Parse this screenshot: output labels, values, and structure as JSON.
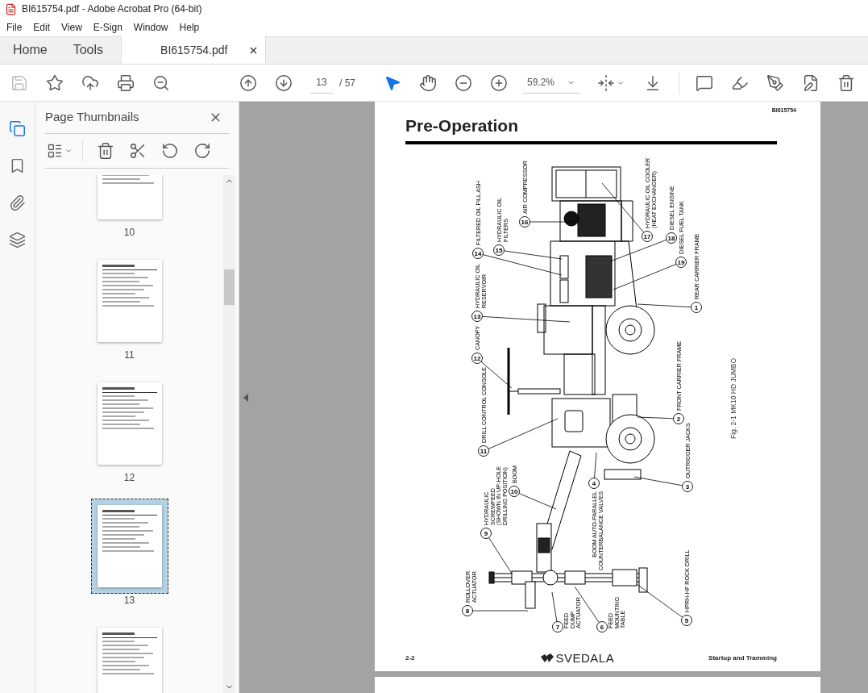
{
  "window": {
    "title": "BI615754.pdf - Adobe Acrobat Pro (64-bit)"
  },
  "menu": [
    "File",
    "Edit",
    "View",
    "E-Sign",
    "Window",
    "Help"
  ],
  "tabs": [
    {
      "label": "Home",
      "selected": false
    },
    {
      "label": "Tools",
      "selected": false
    },
    {
      "label": "BI615754.pdf",
      "selected": true
    }
  ],
  "toolbar": {
    "save_disabled": true,
    "page_current": "13",
    "page_total": "/ 57",
    "zoom": "59.2%",
    "tools": [
      {
        "kind": "select",
        "selected": true
      },
      {
        "kind": "hand",
        "selected": false
      }
    ]
  },
  "sidebar": {
    "rail": [
      {
        "kind": "pages",
        "selected": true
      },
      {
        "kind": "bookmarks",
        "selected": false
      },
      {
        "kind": "attachments",
        "selected": false
      },
      {
        "kind": "layers",
        "selected": false
      }
    ],
    "panel_title": "Page Thumbnails",
    "thumbnails": [
      {
        "label": "10",
        "selected": false
      },
      {
        "label": "11",
        "selected": false
      },
      {
        "label": "12",
        "selected": false
      },
      {
        "label": "13",
        "selected": true
      },
      {
        "selected": false
      }
    ]
  },
  "document": {
    "doc_id": "BI615754",
    "title": "Pre-Operation",
    "callouts": [
      {
        "number": "16",
        "lines": [
          "AIR COMPRESSOR"
        ]
      },
      {
        "number": "17",
        "lines": [
          "HYDRAULIC OIL COOLER",
          "(HEAT EXCHANGER)"
        ]
      },
      {
        "number": "18",
        "lines": [
          "DIESEL ENGINE"
        ]
      },
      {
        "number": "15",
        "lines": [
          "HYDRAULIC OIL",
          "FILTERS"
        ]
      },
      {
        "number": "14",
        "lines": [
          "FILTERED OIL FILL ASH"
        ]
      },
      {
        "number": "19",
        "lines": [
          "DIESEL FUEL TANK"
        ]
      },
      {
        "number": "1",
        "lines": [
          "REAR CARRIER FRAME"
        ]
      },
      {
        "number": "13",
        "lines": [
          "HYDRAULIC OIL",
          "RESERVOIR"
        ]
      },
      {
        "number": "12",
        "lines": [
          "CANOPY"
        ]
      },
      {
        "number": "2",
        "lines": [
          "FRONT CARRIER FRAME"
        ]
      },
      {
        "number": "11",
        "lines": [
          "DRILL CONTROL CONSOLE"
        ]
      },
      {
        "number": "4",
        "lines": [
          "BOOM AUTO-PARALLEL",
          "COUNTERBALANCE VALVES"
        ]
      },
      {
        "number": "3",
        "lines": [
          "OUTRIGGER JACKS"
        ]
      },
      {
        "number": "10",
        "lines": [
          "BOOM"
        ]
      },
      {
        "number": "9",
        "lines": [
          "HYDRAULIC",
          "SCREWFEED",
          "(SHOWN IN UP-HOLE",
          "DRILLING POSITION)"
        ]
      },
      {
        "number": "8",
        "lines": [
          "ROLLOVER",
          "ACTUATOR"
        ]
      },
      {
        "number": "7",
        "lines": [
          "FEED",
          "DUMP",
          "ACTUATOR"
        ]
      },
      {
        "number": "6",
        "lines": [
          "FEED",
          "MOUNTING",
          "TABLE"
        ]
      },
      {
        "number": "5",
        "lines": [
          "HPRH-HF ROCK DRILL"
        ]
      }
    ],
    "figure_caption": "Fig. 2-1  MK10 HD JUMBO",
    "footer": {
      "page_number": "2-2",
      "logo_text": "SVEDALA",
      "section": "Startup and Tramming"
    }
  }
}
